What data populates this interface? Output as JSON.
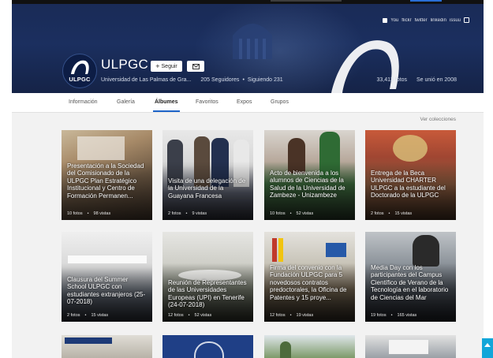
{
  "profile": {
    "name": "ULPGC",
    "logo_text": "ULPGC",
    "follow_label": "Seguir",
    "full_name": "Universidad de Las Palmas de Gra...",
    "followers": "205 Seguidores",
    "following": "Siguiendo 231",
    "photos": "33,413 fotos",
    "joined": "Se unió en 2008"
  },
  "social": [
    "f",
    "You",
    "flickr",
    "twitter",
    "linkedin",
    "issuu",
    "ig"
  ],
  "tabs": [
    "Información",
    "Galería",
    "Álbumes",
    "Favoritos",
    "Expos",
    "Grupos"
  ],
  "active_tab": "Álbumes",
  "see_all": "Ver colecciones",
  "albums": [
    {
      "title": "Presentación a la Sociedad del Comisionado de la ULPGC Plan Estratégico Institucional y Centro de Formación Permanen...",
      "photos": "10 fotos",
      "views": "98 vistas"
    },
    {
      "title": "Visita de una delegación de la Universidad de la Guayana Francesa",
      "photos": "2 fotos",
      "views": "9 vistas"
    },
    {
      "title": "Acto de bienvenida a los alumnos de Ciencias de la Salud de la Universidad de Zambeze - Unizambeze",
      "photos": "10 fotos",
      "views": "52 vistas"
    },
    {
      "title": "Entrega de la Beca Universidad CHARTER ULPGC a la estudiante del Doctorado de la ULPGC",
      "photos": "2 fotos",
      "views": "15 vistas"
    },
    {
      "title": "Clausura del Summer School ULPGC con estudiantes extranjeros (25-07-2018)",
      "photos": "2 fotos",
      "views": "15 vistas"
    },
    {
      "title": "Reunión de Representantes de las Universidades Europeas (UPI) en Tenerife (24-07-2018)",
      "photos": "12 fotos",
      "views": "52 vistas"
    },
    {
      "title": "Firma del convenio con la Fundación ULPGC para 5 novedosos contratos predoctorales, la Oficina de Patentes y 15 proye...",
      "photos": "12 fotos",
      "views": "19 vistas"
    },
    {
      "title": "Media Day con los participantes del Campus Científico de Verano de la Tecnología en el laboratorio de Ciencias del Mar",
      "photos": "19 fotos",
      "views": "165 vistas"
    }
  ],
  "colors": {
    "cover": "#1b2f5f",
    "accent": "#1d64c8",
    "scroll_button": "#12a6d9"
  }
}
